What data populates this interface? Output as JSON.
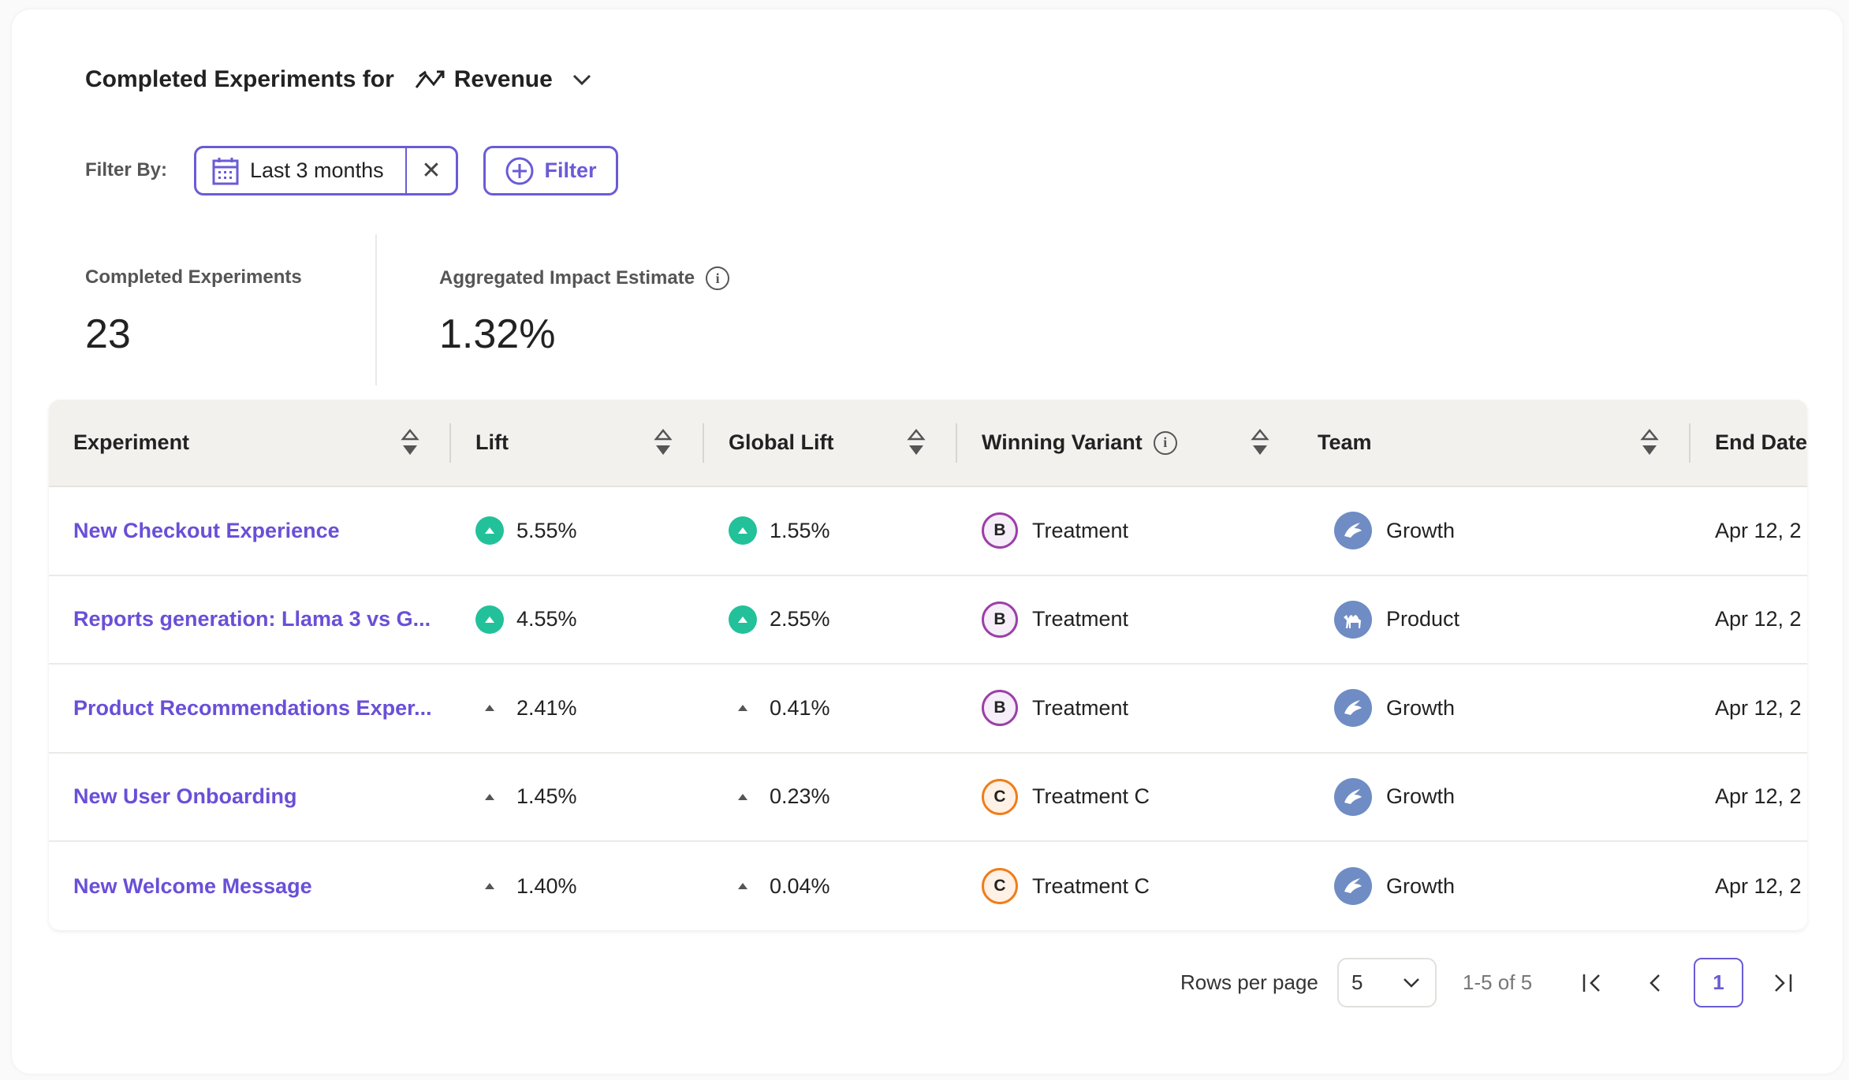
{
  "header": {
    "title": "Completed Experiments for",
    "metric": "Revenue",
    "metric_icon": "trend-icon"
  },
  "filters": {
    "label": "Filter By:",
    "date_chip": "Last 3 months",
    "add_filter": "Filter"
  },
  "stats": [
    {
      "label": "Completed Experiments",
      "value": "23"
    },
    {
      "label": "Aggregated Impact Estimate",
      "value": "1.32%"
    }
  ],
  "colors": {
    "accent": "#6a5bd6",
    "positive": "#22c19a",
    "variant_b": "#9b3fa8",
    "variant_c": "#f07d1a",
    "team": "#6f8dc4"
  },
  "table": {
    "columns": [
      "Experiment",
      "Lift",
      "Global Lift",
      "Winning Variant",
      "Team",
      "End Date"
    ],
    "rows": [
      {
        "experiment": "New Checkout Experience",
        "lift": "5.55%",
        "global_lift": "1.55%",
        "significant": true,
        "variant_badge": "B",
        "variant": "Treatment",
        "team": "Growth",
        "team_icon": "crocodile-icon",
        "end_date": "Apr 12, 2"
      },
      {
        "experiment": "Reports generation: Llama 3 vs G...",
        "lift": "4.55%",
        "global_lift": "2.55%",
        "significant": true,
        "variant_badge": "B",
        "variant": "Treatment",
        "team": "Product",
        "team_icon": "camel-icon",
        "end_date": "Apr 12, 2"
      },
      {
        "experiment": "Product Recommendations Exper...",
        "lift": "2.41%",
        "global_lift": "0.41%",
        "significant": false,
        "variant_badge": "B",
        "variant": "Treatment",
        "team": "Growth",
        "team_icon": "crocodile-icon",
        "end_date": "Apr 12, 2"
      },
      {
        "experiment": "New User Onboarding",
        "lift": "1.45%",
        "global_lift": "0.23%",
        "significant": false,
        "variant_badge": "C",
        "variant": "Treatment C",
        "team": "Growth",
        "team_icon": "crocodile-icon",
        "end_date": "Apr 12, 2"
      },
      {
        "experiment": "New Welcome Message",
        "lift": "1.40%",
        "global_lift": "0.04%",
        "significant": false,
        "variant_badge": "C",
        "variant": "Treatment C",
        "team": "Growth",
        "team_icon": "crocodile-icon",
        "end_date": "Apr 12, 2"
      }
    ]
  },
  "pagination": {
    "rows_per_page_label": "Rows per page",
    "rows_per_page": "5",
    "range": "1-5 of 5",
    "current_page": "1"
  }
}
